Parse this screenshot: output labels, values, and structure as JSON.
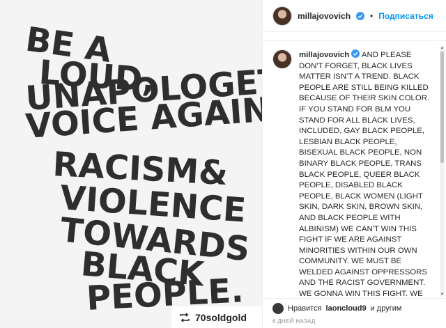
{
  "poster": {
    "lines": [
      "BE A",
      "LOUD,",
      "UNAPOLOGETIC",
      "VOICE AGAINST",
      "RACISM&",
      "VIOLENCE",
      "TOWARDS",
      "BLACK",
      "PEOPLE."
    ]
  },
  "repost": {
    "username": "70soldgold",
    "icon": "repost-icon"
  },
  "header": {
    "username": "millajovovich",
    "verified_icon": "verified-badge-icon",
    "follow_label": "Подписаться",
    "separator": "•"
  },
  "caption": {
    "username": "millajovovich",
    "text": "AND PLEASE DON'T FORGET, BLACK LIVES MATTER ISN'T A TREND. BLACK PEOPLE ARE STILL BEING KILLED BECAUSE OF THEIR SKIN COLOR. IF YOU STAND FOR BLM YOU STAND FOR ALL BLACK LIVES, INCLUDED, GAY BLACK PEOPLE, LESBIAN BLACK PEOPLE, BISEXUAL BLACK PEOPLE, NON BINARY BLACK PEOPLE, TRANS BLACK PEOPLE, QUEER BLACK PEOPLE, DISABLED BLACK PEOPLE, BLACK WOMEN (LIGHT SKIN, DARK SKIN, BROWN SKIN, AND BLACK PEOPLE WITH ALBINISM) WE CAN'T WIN THIS FIGHT IF WE ARE AGAINST MINORITIES WITHIN OUR OWN COMMUNITY. WE MUST BE WELDED AGAINST OPPRESSORS AND THE RACIST GOVERNMENT. WE GONNA WIN THIS FIGHT. WE MUST HAVE JUSTICE FOR OUR BROTHERS AND SISTERS WHO WERE WILDLY KILLED. ALL BLACK"
  },
  "footer": {
    "liked_prefix": "Нравится",
    "liked_user": "laoncloud9",
    "liked_suffix": "и другим",
    "date": "6 ДНЕЙ НАЗАД"
  },
  "colors": {
    "link": "#0095f6",
    "text": "#262626",
    "muted": "#8e8e8e",
    "poster_ink": "#2e2e2e"
  }
}
